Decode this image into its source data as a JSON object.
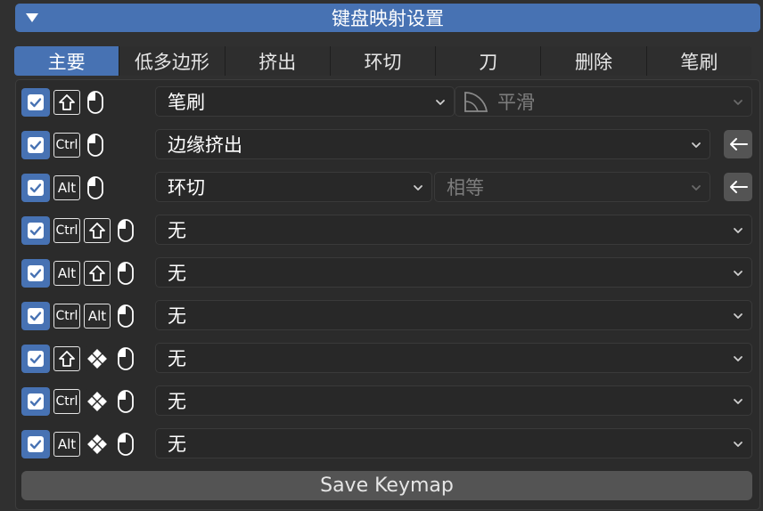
{
  "panel": {
    "title": "键盘映射设置"
  },
  "tabs": [
    "主要",
    "低多边形",
    "挤出",
    "环切",
    "刀",
    "删除",
    "笔刷"
  ],
  "keys": {
    "ctrl": "Ctrl",
    "alt": "Alt"
  },
  "rows": [
    {
      "action": "笔刷",
      "secondary": "平滑"
    },
    {
      "action": "边缘挤出"
    },
    {
      "action": "环切",
      "secondary": "相等"
    },
    {
      "action": "无"
    },
    {
      "action": "无"
    },
    {
      "action": "无"
    },
    {
      "action": "无"
    },
    {
      "action": "无"
    },
    {
      "action": "无"
    }
  ],
  "footer": {
    "save_label": "Save Keymap"
  },
  "colors": {
    "accent": "#4772b3",
    "background": "#303030",
    "button": "#545454"
  }
}
